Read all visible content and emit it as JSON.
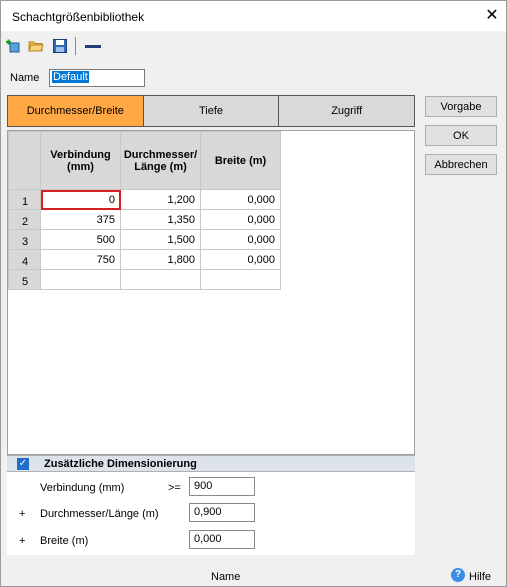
{
  "window": {
    "title": "Schachtgrößenbibliothek",
    "close_icon": "close-icon"
  },
  "toolbar": {
    "icons": [
      "add-icon",
      "open-folder-icon",
      "save-icon",
      "minus-icon"
    ]
  },
  "name_field": {
    "label": "Name",
    "value": "Default"
  },
  "tabs": [
    {
      "label": "Durchmesser/Breite",
      "active": true
    },
    {
      "label": "Tiefe",
      "active": false
    },
    {
      "label": "Zugriff",
      "active": false
    }
  ],
  "buttons": {
    "vorgabe": "Vorgabe",
    "ok": "OK",
    "abbrechen": "Abbrechen"
  },
  "table": {
    "headers": [
      "Verbindung\n(mm)",
      "Durchmesser/\nLänge (m)",
      "Breite (m)"
    ],
    "header_lines": [
      [
        "Verbindung",
        "(mm)"
      ],
      [
        "Durchmesser/",
        "Länge (m)"
      ],
      [
        "Breite (m)",
        ""
      ]
    ],
    "rows": [
      {
        "num": "1",
        "cells": [
          "0",
          "1,200",
          "0,000"
        ]
      },
      {
        "num": "2",
        "cells": [
          "375",
          "1,350",
          "0,000"
        ]
      },
      {
        "num": "3",
        "cells": [
          "500",
          "1,500",
          "0,000"
        ]
      },
      {
        "num": "4",
        "cells": [
          "750",
          "1,800",
          "0,000"
        ]
      },
      {
        "num": "5",
        "cells": [
          "",
          "",
          ""
        ]
      }
    ]
  },
  "dimension": {
    "title": "Zusätzliche Dimensionierung",
    "checked": true,
    "rows": [
      {
        "prefix": "",
        "label": "Verbindung (mm)",
        "operator": ">=",
        "value": "900"
      },
      {
        "prefix": "+",
        "label": "Durchmesser/Länge (m)",
        "operator": "",
        "value": "0,900"
      },
      {
        "prefix": "+",
        "label": "Breite (m)",
        "operator": "",
        "value": "0,000"
      }
    ]
  },
  "status": {
    "center": "Name",
    "help": "Hilfe"
  },
  "colors": {
    "active_tab": "#ffa844",
    "accent": "#1f6fc9",
    "selection_border": "#d42020"
  }
}
